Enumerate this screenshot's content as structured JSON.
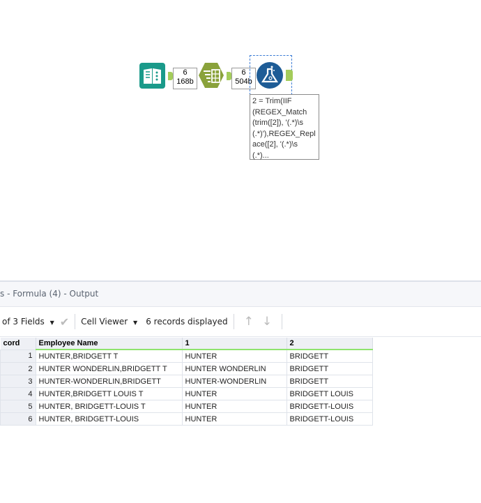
{
  "workflow": {
    "connection1": {
      "records": "6",
      "size": "168b"
    },
    "connection2": {
      "records": "6",
      "size": "504b"
    },
    "annotation": "2 = Trim(IIF\n(REGEX_Match\n(trim([2]), '(.*)\\s\n(.*)'),REGEX_Repl\nace([2], '(.*)\\s\n(.*)..."
  },
  "results": {
    "title": "s - Formula (4) - Output",
    "fields_label": "of 3 Fields",
    "cell_viewer_label": "Cell Viewer",
    "records_displayed": "6 records displayed",
    "columns": [
      "cord",
      "Employee Name",
      "1",
      "2"
    ],
    "rows": [
      [
        "1",
        "HUNTER,BRIDGETT T",
        "HUNTER",
        "BRIDGETT"
      ],
      [
        "2",
        "HUNTER WONDERLIN,BRIDGETT T",
        "HUNTER WONDERLIN",
        "BRIDGETT"
      ],
      [
        "3",
        "HUNTER-WONDERLIN,BRIDGETT",
        "HUNTER-WONDERLIN",
        "BRIDGETT"
      ],
      [
        "4",
        "HUNTER,BRIDGETT LOUIS T",
        "HUNTER",
        "BRIDGETT LOUIS"
      ],
      [
        "5",
        "HUNTER, BRIDGETT-LOUIS T",
        "HUNTER",
        "BRIDGETT-LOUIS"
      ],
      [
        "6",
        "HUNTER, BRIDGETT-LOUIS",
        "HUNTER",
        "BRIDGETT-LOUIS"
      ]
    ]
  }
}
